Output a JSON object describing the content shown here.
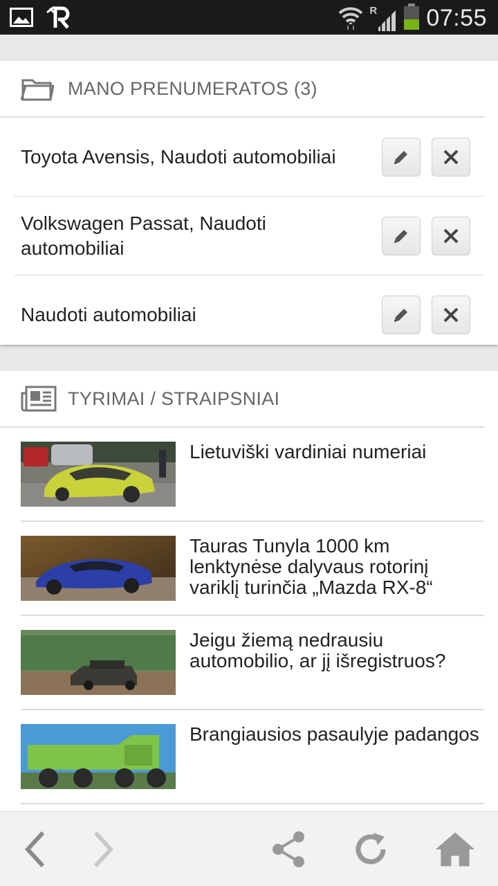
{
  "status_bar": {
    "time": "07:55",
    "icons": [
      "image-icon",
      "app-r-icon",
      "wifi-icon",
      "signal-roaming-icon",
      "battery-icon"
    ],
    "roaming_label": "R",
    "battery_color": "#7ab317"
  },
  "subscriptions": {
    "icon": "folder-icon",
    "title": "MANO PRENUMERATOS (3)",
    "items": [
      {
        "label": "Toyota Avensis, Naudoti automobiliai"
      },
      {
        "label": "Volkswagen Passat, Naudoti automobiliai"
      },
      {
        "label": "Naudoti automobiliai"
      }
    ]
  },
  "articles": {
    "icon": "newspaper-icon",
    "title": "TYRIMAI / STRAIPSNIAI",
    "items": [
      {
        "title": "Lietuviški vardiniai numeriai",
        "thumb": "yellow-supercar-photo"
      },
      {
        "title": "Tauras Tunyla 1000 km lenktynėse dalyvaus rotorinį variklį turinčia „Mazda RX-8“",
        "thumb": "blue-mazda-photo"
      },
      {
        "title": "Jeigu žiemą nedrausiu automobilio, ar jį išregistruos?",
        "thumb": "old-sedan-photo"
      },
      {
        "title": "Brangiausios pasaulyje padangos",
        "thumb": "green-dump-truck-photo"
      }
    ]
  },
  "bottom_bar": {
    "icons": [
      "back-icon",
      "forward-icon",
      "share-icon",
      "refresh-icon",
      "home-icon"
    ]
  }
}
